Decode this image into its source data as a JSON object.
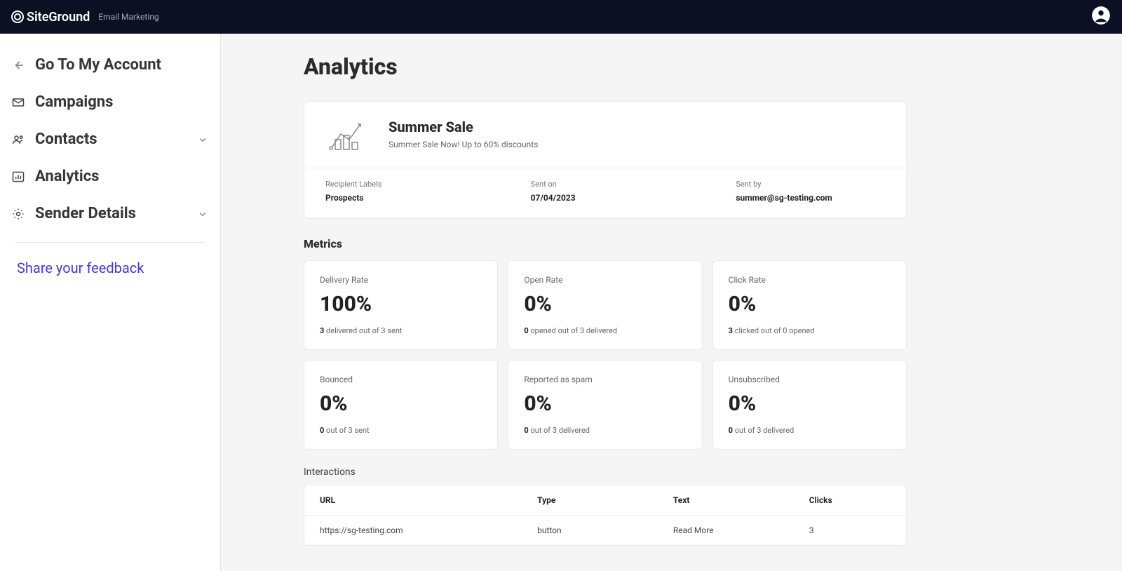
{
  "topbar": {
    "brand": "SiteGround",
    "subtitle": "Email Marketing"
  },
  "sidebar": {
    "back": "Go To My Account",
    "items": [
      {
        "label": "Campaigns",
        "icon": "mail-icon",
        "expandable": false
      },
      {
        "label": "Contacts",
        "icon": "people-icon",
        "expandable": true
      },
      {
        "label": "Analytics",
        "icon": "bar-chart-icon",
        "expandable": false
      },
      {
        "label": "Sender Details",
        "icon": "gear-icon",
        "expandable": true
      }
    ],
    "feedback": "Share your feedback"
  },
  "page": {
    "title": "Analytics"
  },
  "campaign": {
    "title": "Summer Sale",
    "description": "Summer Sale Now! Up to 60% discounts",
    "meta": {
      "recipient_label_title": "Recipient Labels",
      "recipient_label_value": "Prospects",
      "sent_on_title": "Sent on",
      "sent_on_value": "07/04/2023",
      "sent_by_title": "Sent by",
      "sent_by_value": "summer@sg-testing.com"
    }
  },
  "metrics": {
    "section_title": "Metrics",
    "cards": [
      {
        "name": "Delivery Rate",
        "value": "100%",
        "bold": "3",
        "detail": " delivered out of 3 sent"
      },
      {
        "name": "Open Rate",
        "value": "0%",
        "bold": "0",
        "detail": " opened out of 3 delivered"
      },
      {
        "name": "Click Rate",
        "value": "0%",
        "bold": "3",
        "detail": " clicked out of 0 opened"
      },
      {
        "name": "Bounced",
        "value": "0%",
        "bold": "0",
        "detail": " out of 3 sent"
      },
      {
        "name": "Reported as spam",
        "value": "0%",
        "bold": "0",
        "detail": " out of 3 delivered"
      },
      {
        "name": "Unsubscribed",
        "value": "0%",
        "bold": "0",
        "detail": " out of 3 delivered"
      }
    ]
  },
  "interactions": {
    "title": "Interactions",
    "headers": {
      "url": "URL",
      "type": "Type",
      "text": "Text",
      "clicks": "Clicks"
    },
    "rows": [
      {
        "url": "https://sg-testing.com",
        "type": "button",
        "text": "Read More",
        "clicks": "3"
      }
    ]
  }
}
